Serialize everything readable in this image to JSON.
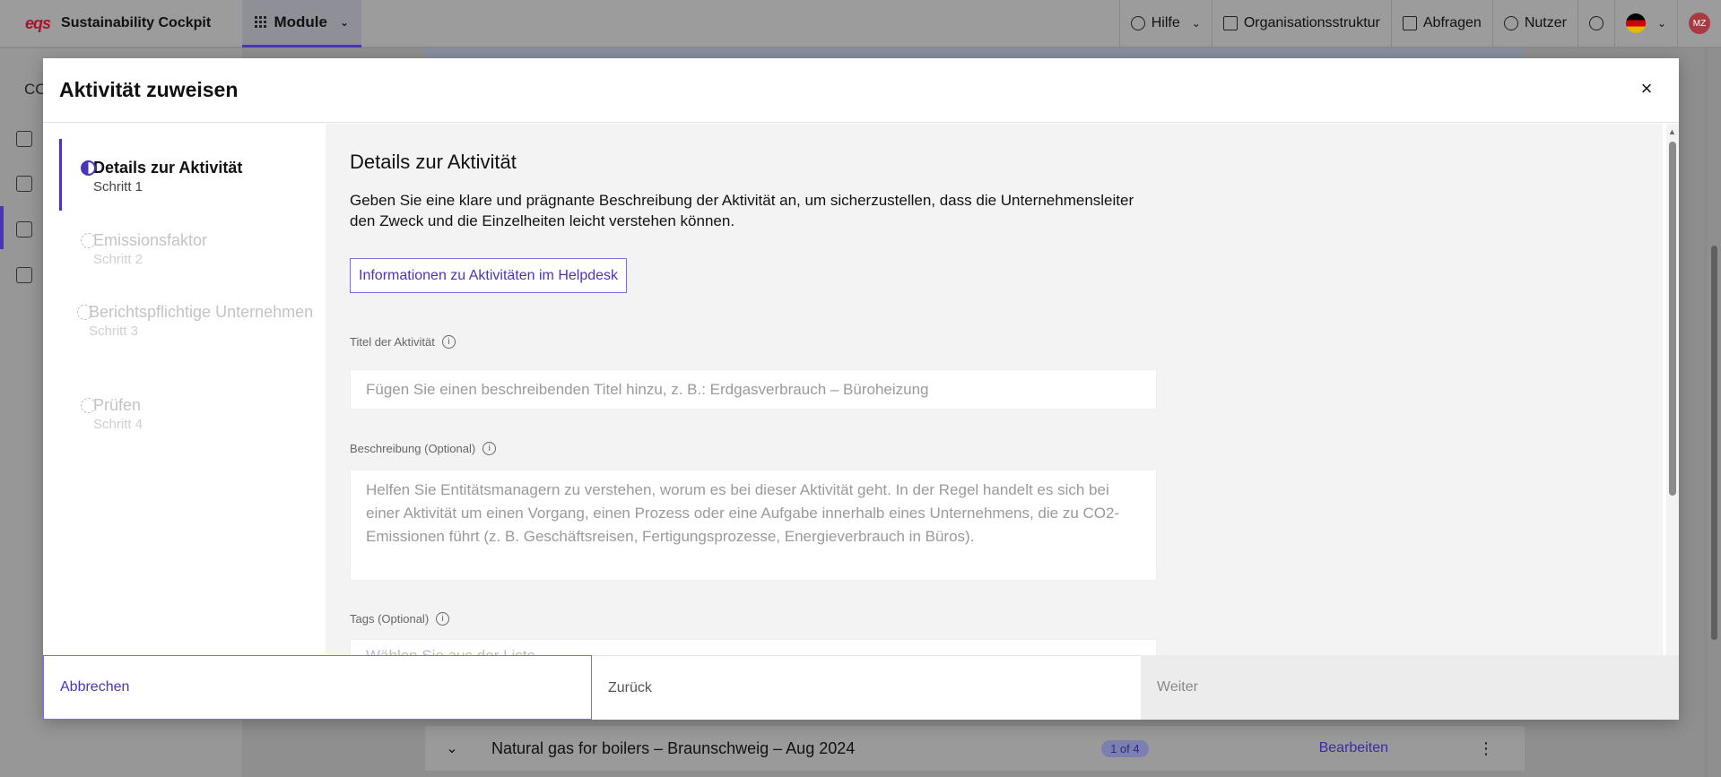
{
  "app": {
    "logo": "eqs",
    "name": "Sustainability Cockpit",
    "module_label": "Module",
    "nav": {
      "help": "Hilfe",
      "org": "Organisationsstruktur",
      "queries": "Abfragen",
      "users": "Nutzer",
      "avatar": "MZ"
    },
    "rail_title": "CO",
    "bg_row": {
      "title": "Natural gas for boilers – Braunschweig – Aug 2024",
      "badge": "1 of 4",
      "edit": "Bearbeiten"
    }
  },
  "modal": {
    "title": "Aktivität zuweisen",
    "close_icon": "close-icon",
    "steps": [
      {
        "label": "Details zur Aktivität",
        "sub": "Schritt 1",
        "state": "current"
      },
      {
        "label": "Emissionsfaktor",
        "sub": "Schritt 2",
        "state": "pending"
      },
      {
        "label": "Berichtspflichtige Unternehmen",
        "sub": "Schritt 3",
        "state": "pending"
      },
      {
        "label": "Prüfen",
        "sub": "Schritt 4",
        "state": "pending"
      }
    ],
    "section": {
      "title": "Details zur Aktivität",
      "description": "Geben Sie eine klare und prägnante Beschreibung der Aktivität an, um sicherzustellen, dass die Unternehmensleiter den Zweck und die Einzelheiten leicht verstehen können.",
      "helpdesk_link": "Informationen zu Aktivitäten im Helpdesk"
    },
    "fields": {
      "title_label": "Titel der Aktivität",
      "title_placeholder": "Fügen Sie einen beschreibenden Titel hinzu, z. B.: Erdgasverbrauch – Büroheizung",
      "desc_label": "Beschreibung (Optional)",
      "desc_placeholder": "Helfen Sie Entitätsmanagern zu verstehen, worum es bei dieser Aktivität geht. In der Regel handelt es sich bei einer Aktivität um einen Vorgang, einen Prozess oder eine Aufgabe innerhalb eines Unternehmens, die zu CO2-Emissionen führt (z. B. Geschäftsreisen, Fertigungsprozesse, Energieverbrauch in Büros).",
      "tags_label": "Tags (Optional)",
      "tags_placeholder": "Wählen Sie aus der Liste"
    },
    "footer": {
      "cancel": "Abbrechen",
      "back": "Zurück",
      "next": "Weiter"
    }
  },
  "colors": {
    "accent": "#4a35b8",
    "brand": "#a3172a",
    "overlay": "#8c8c8c"
  }
}
